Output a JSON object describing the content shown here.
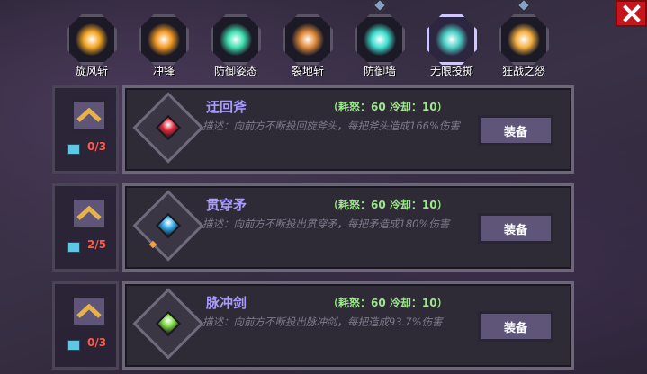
{
  "skill_bar": [
    {
      "name": "旋风斩",
      "icon": "whirlwind-slash-icon",
      "color": "#f5a623",
      "marker": false,
      "selected": false
    },
    {
      "name": "冲锋",
      "icon": "charge-icon",
      "color": "#f59a23",
      "marker": false,
      "selected": false
    },
    {
      "name": "防御姿态",
      "icon": "defense-stance-icon",
      "color": "#3fe0b0",
      "marker": false,
      "selected": false
    },
    {
      "name": "裂地斩",
      "icon": "ground-split-icon",
      "color": "#e08a3a",
      "marker": false,
      "selected": false
    },
    {
      "name": "防御墙",
      "icon": "defense-wall-icon",
      "color": "#3fe0d0",
      "marker": true,
      "selected": false
    },
    {
      "name": "无限投掷",
      "icon": "infinite-throw-icon",
      "color": "#4cd2c8",
      "marker": false,
      "selected": true
    },
    {
      "name": "狂战之怒",
      "icon": "berserk-rage-icon",
      "color": "#f5b040",
      "marker": true,
      "selected": false
    }
  ],
  "rows": [
    {
      "title": "迂回斧",
      "stats": "（耗怒：60  冷却：10）",
      "desc": "描述：向前方不断投回旋斧头，每把斧头造成166%伤害",
      "count": "0/3",
      "button": "装备",
      "jewel_color": "#e0283a"
    },
    {
      "title": "贯穿矛",
      "stats": "（耗怒：60  冷却：10）",
      "desc": "描述：向前方不断投出贯穿矛，每把矛造成180%伤害",
      "count": "2/5",
      "button": "装备",
      "jewel_color": "#2fa8e8"
    },
    {
      "title": "脉冲剑",
      "stats": "（耗怒：60  冷却：10）",
      "desc": "描述：向前方不断投出脉冲剑，每把造成93.7%伤害",
      "count": "0/3",
      "button": "装备",
      "jewel_color": "#7ad83a"
    }
  ]
}
